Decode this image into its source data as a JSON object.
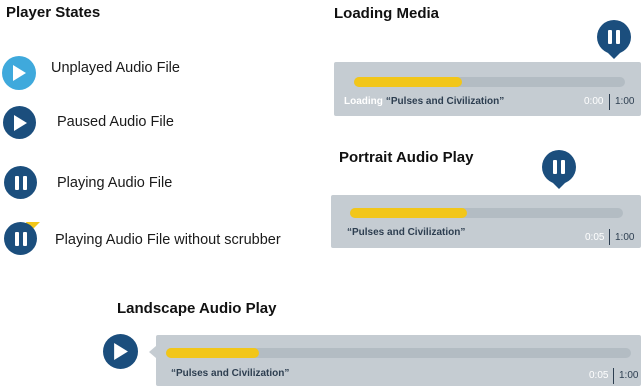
{
  "colors": {
    "dark_blue": "#1b4e7d",
    "light_blue": "#3fa9dc",
    "yellow": "#f2c619",
    "panel_gray": "#c5ccd2",
    "track_gray": "#b3bcc3"
  },
  "player_states": {
    "heading": "Player States",
    "items": [
      {
        "label": "Unplayed Audio File",
        "icon": "play-icon"
      },
      {
        "label": "Paused Audio File",
        "icon": "play-icon"
      },
      {
        "label": "Playing Audio File",
        "icon": "pause-icon"
      },
      {
        "label": "Playing Audio File without scrubber",
        "icon": "pause-icon"
      }
    ]
  },
  "loading_media": {
    "heading": "Loading Media",
    "status_word": "Loading",
    "track_title": "“Pulses and Civilization”",
    "elapsed": "0:00",
    "total": "1:00",
    "progress": 0.4
  },
  "portrait_play": {
    "heading": "Portrait Audio Play",
    "track_title": "“Pulses and Civilization”",
    "elapsed": "0:05",
    "total": "1:00",
    "progress": 0.43
  },
  "landscape_play": {
    "heading": "Landscape Audio Play",
    "track_title": "“Pulses and Civilization”",
    "elapsed": "0:05",
    "total": "1:00",
    "progress": 0.2
  }
}
